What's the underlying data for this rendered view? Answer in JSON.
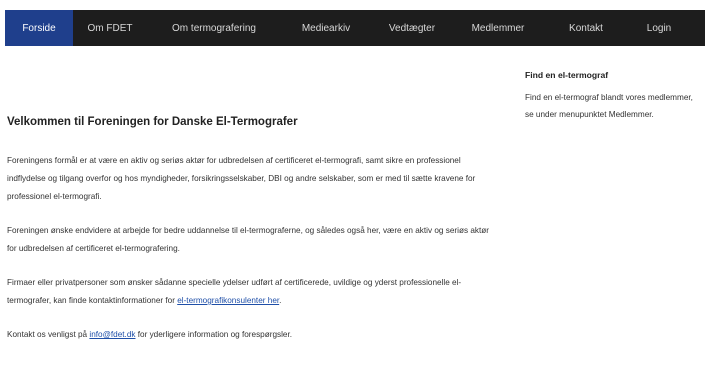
{
  "nav": {
    "items": [
      {
        "label": "Forside",
        "active": true
      },
      {
        "label": "Om FDET",
        "active": false
      },
      {
        "label": "Om termografering",
        "active": false
      },
      {
        "label": "Mediearkiv",
        "active": false
      },
      {
        "label": "Vedtægter",
        "active": false
      },
      {
        "label": "Medlemmer",
        "active": false
      },
      {
        "label": "Kontakt",
        "active": false
      },
      {
        "label": "Login",
        "active": false
      }
    ]
  },
  "main": {
    "title": "Velkommen til Foreningen for Danske El-Termografer",
    "paragraph1": "Foreningens formål er at være en aktiv og seriøs aktør for udbredelsen af certificeret el-termografi, samt sikre en professionel indflydelse og tilgang overfor og hos myndigheder, forsikringsselskaber, DBI og andre selskaber, som er med til sætte kravene for professionel el-termografi.",
    "paragraph2": "Foreningen ønske endvidere at arbejde for bedre uddannelse til el-termograferne, og således også her, være en aktiv og seriøs aktør for udbredelsen af certificeret el-termografering.",
    "paragraph3_text": "Firmaer eller privatpersoner som ønsker sådanne specielle ydelser udført af certificerede, uvildige og yderst professionelle el-termografer, kan finde kontaktinformationer for ",
    "paragraph3_link": "el-termografikonsulenter her",
    "paragraph3_end": ".",
    "contact_text": "Kontakt os venligst på ",
    "contact_email": "info@fdet.dk",
    "contact_end": " for yderligere information og forespørgsler."
  },
  "sidebar": {
    "title": "Find en el-termograf",
    "text": "Find en el-termograf blandt vores medlemmer, se under menupunktet Medlemmer."
  },
  "colors": {
    "navbar_bg": "#1d1d1d",
    "nav_active_bg": "#1f3f8c",
    "link": "#1f4fa8"
  }
}
